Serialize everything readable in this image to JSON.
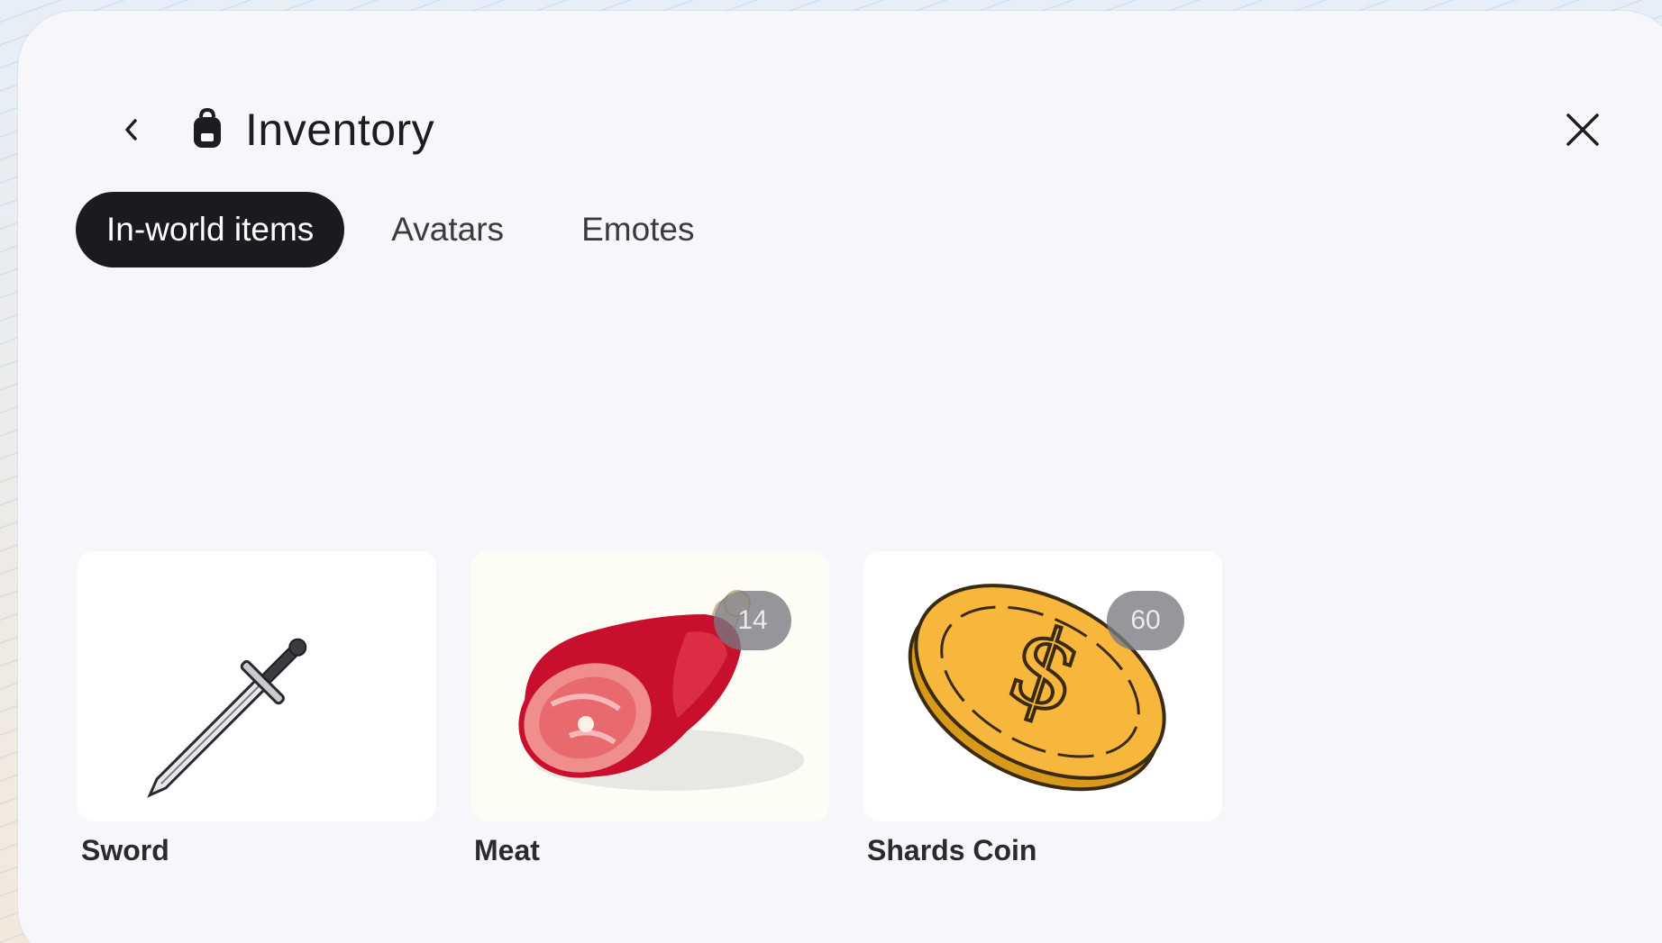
{
  "header": {
    "title": "Inventory",
    "back_icon": "chevron-left-icon",
    "title_icon": "backpack-icon",
    "close_icon": "close-icon"
  },
  "tabs": [
    {
      "label": "In-world items",
      "active": true
    },
    {
      "label": "Avatars",
      "active": false
    },
    {
      "label": "Emotes",
      "active": false
    }
  ],
  "items": [
    {
      "name": "Sword",
      "icon": "sword-icon",
      "count": null
    },
    {
      "name": "Meat",
      "icon": "meat-icon",
      "count": "14"
    },
    {
      "name": "Shards Coin",
      "icon": "coin-icon",
      "count": "60"
    }
  ],
  "colors": {
    "active_tab_bg": "#1b1b1f",
    "panel_bg": "#f6f6fb",
    "badge_bg": "#78787f"
  }
}
